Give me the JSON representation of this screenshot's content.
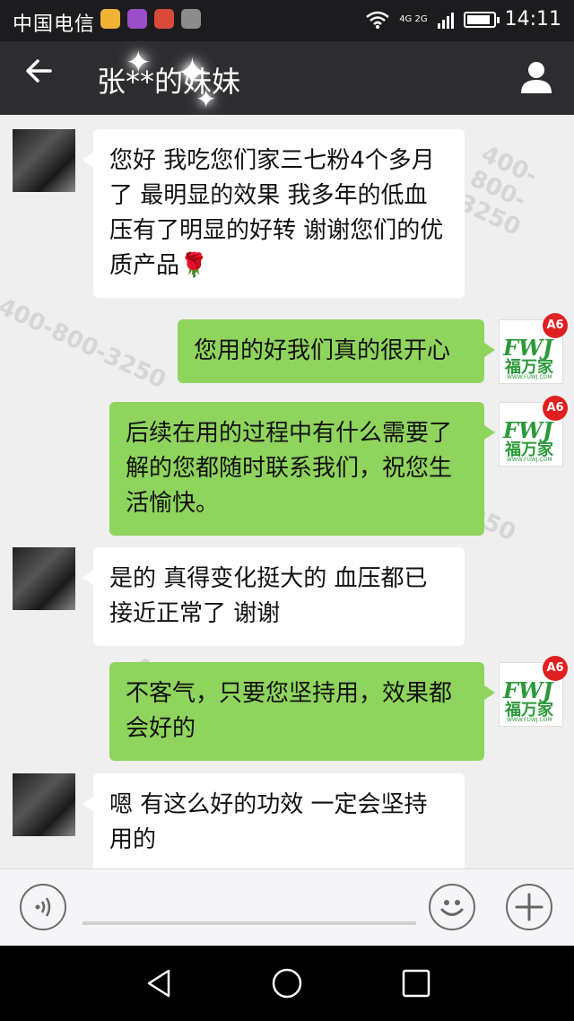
{
  "status_bar": {
    "carrier": "中国电信",
    "network": "4G 2G",
    "time": "14:11",
    "battery_percent": 90
  },
  "header": {
    "title": "张**的妹妹"
  },
  "watermark": {
    "text": "400-800-3250"
  },
  "messages": [
    {
      "side": "left",
      "text": "您好 我吃您们家三七粉4个多月了 最明显的效果 我多年的低血压有了明显的好转 谢谢您们的优质产品",
      "emoji": "🌹"
    },
    {
      "side": "right",
      "text": "您用的好我们真的很开心"
    },
    {
      "side": "right",
      "text": "后续在用的过程中有什么需要了解的您都随时联系我们，祝您生活愉快。"
    },
    {
      "side": "left",
      "text": "是的 真得变化挺大的 血压都已接近正常了 谢谢"
    },
    {
      "side": "right",
      "text": "不客气，只要您坚持用，效果都会好的"
    },
    {
      "side": "left",
      "text": "嗯 有这么好的功效 一定会坚持用的"
    }
  ],
  "brand_avatar": {
    "badge": "A6",
    "logo": "FWJ",
    "name": "福万家",
    "url": "WWW.FUWJ.COM"
  },
  "icons": {
    "back": "arrow-left-icon",
    "profile": "person-icon",
    "voice": "voice-icon",
    "emoji": "smiley-icon",
    "more": "plus-icon"
  }
}
